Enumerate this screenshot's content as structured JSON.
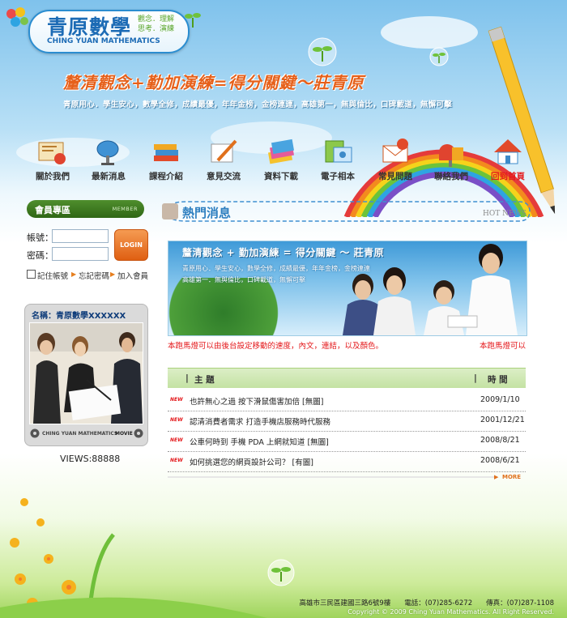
{
  "header": {
    "logo_zh": "青原數學",
    "logo_side_1": "觀念．理解",
    "logo_side_2": "思考．演練",
    "logo_en": "CHING YUAN MATHEMATICS",
    "slogan": "釐清觀念+勤加演練=得分關鍵～莊青原",
    "subline": "青原用心．學生安心，數學全修，成績最優，年年金榜，金榜連連，高雄第一，無與倫比，口碑載道，無懈可擊"
  },
  "nav": {
    "items": [
      {
        "label": "關於我們",
        "icon": "certificate-icon"
      },
      {
        "label": "最新消息",
        "icon": "satellite-dish-icon"
      },
      {
        "label": "課程介紹",
        "icon": "books-icon"
      },
      {
        "label": "意見交流",
        "icon": "pen-paper-icon"
      },
      {
        "label": "資料下載",
        "icon": "cards-icon"
      },
      {
        "label": "電子相本",
        "icon": "photo-album-icon"
      },
      {
        "label": "常見問題",
        "icon": "question-mail-icon"
      },
      {
        "label": "聯絡我們",
        "icon": "mailbox-icon"
      },
      {
        "label": "回到首頁",
        "icon": "home-icon"
      }
    ]
  },
  "member": {
    "title": "會員專區",
    "tag": "MEMBER",
    "account_label": "帳號：",
    "password_label": "密碼：",
    "login_label": "LOGIN",
    "remember_label": "記住帳號",
    "forgot_label": "忘記密碼",
    "join_label": "加入會員"
  },
  "movie": {
    "name": "名稱：青原數學XXXXXX",
    "footer": "CHING YUAN MATHEMATICS",
    "footer_tag": "MOVIE",
    "views": "VIEWS:88888"
  },
  "hot": {
    "title": "熱門消息",
    "en": "HOT NEWS",
    "banner_title": "釐清觀念 + 勤加演練 = 得分關鍵 ～ 莊青原",
    "banner_sub_1": "青原用心．學生安心，數學全修，成績最優，年年金榜，金榜連連",
    "banner_sub_2": "高雄第一．無與倫比，口碑載道，無懈可擊",
    "marquee": "本跑馬燈可以由後台設定移動的速度，內文，連結，以及顏色。",
    "marquee2": "本跑馬燈可以"
  },
  "news": {
    "col_subject": "主 題",
    "col_time": "時 間",
    "badge": "NEW",
    "rows": [
      {
        "title": "也許無心之過 按下滑鼠傷害加倍 [無圖]",
        "date": "2009/1/10"
      },
      {
        "title": "認清消費者需求 打造手機店服務時代服務",
        "date": "2001/12/21"
      },
      {
        "title": "公車何時到 手機 PDA 上網就知道 [無圖]",
        "date": "2008/8/21"
      },
      {
        "title": "如何挑選您的網頁設計公司？ [有圖]",
        "date": "2008/6/21"
      }
    ],
    "more": "MORE"
  },
  "footer": {
    "line1": "高雄市三民區建國三路6號9樓　　電話：(07)285-6272　　傳真：(07)287-1108",
    "line2": "Copyright © 2009 Ching Yuan Mathematics. All Right Reserved."
  }
}
